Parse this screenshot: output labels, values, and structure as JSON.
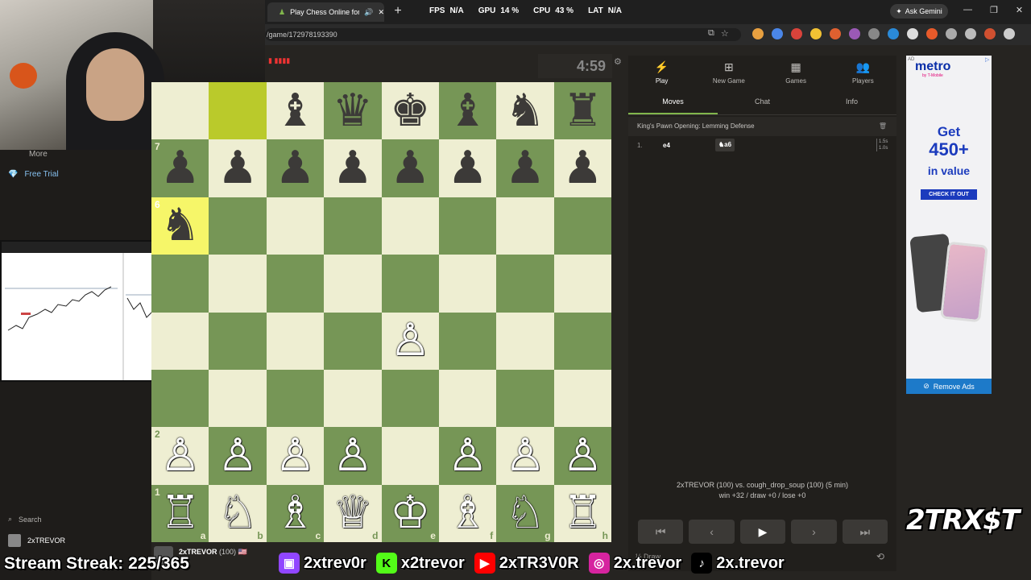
{
  "browser": {
    "tab_title": "Play Chess Online for FREE",
    "url": "/game/172978193390",
    "stats": [
      {
        "label": "FPS",
        "value": "N/A"
      },
      {
        "label": "GPU",
        "value": "14 %"
      },
      {
        "label": "CPU",
        "value": "43 %"
      },
      {
        "label": "LAT",
        "value": "N/A"
      }
    ],
    "gemini_label": "Ask Gemini"
  },
  "sidebar": {
    "more": "More",
    "free_trial": "Free Trial",
    "search": "Search",
    "user": "2xTREVOR"
  },
  "game": {
    "clock": "4:59",
    "player_name": "2xTREVOR",
    "player_rating": "(100)",
    "board": [
      [
        "",
        "",
        "♝",
        "♛",
        "♚",
        "♝",
        "♞",
        "♜"
      ],
      [
        "♟",
        "♟",
        "♟",
        "♟",
        "♟",
        "♟",
        "♟",
        "♟"
      ],
      [
        "♞",
        "",
        "",
        "",
        "",
        "",
        "",
        ""
      ],
      [
        "",
        "",
        "",
        "",
        "",
        "",
        "",
        ""
      ],
      [
        "",
        "",
        "",
        "",
        "♙",
        "",
        "",
        ""
      ],
      [
        "",
        "",
        "",
        "",
        "",
        "",
        "",
        ""
      ],
      [
        "♙",
        "♙",
        "♙",
        "♙",
        "",
        "♙",
        "♙",
        "♙"
      ],
      [
        "♖",
        "♘",
        "♗",
        "♕",
        "♔",
        "♗",
        "♘",
        "♖"
      ]
    ],
    "ranks_shown": [
      "7",
      "6",
      "2",
      "1"
    ],
    "files": [
      "a",
      "b",
      "c",
      "d",
      "e",
      "f",
      "g",
      "h"
    ]
  },
  "panel": {
    "nav": [
      {
        "icon": "⚡",
        "label": "Play"
      },
      {
        "icon": "⊞",
        "label": "New Game"
      },
      {
        "icon": "▦",
        "label": "Games"
      },
      {
        "icon": "👥",
        "label": "Players"
      }
    ],
    "tabs": [
      "Moves",
      "Chat",
      "Info"
    ],
    "opening": "King's Pawn Opening: Lemming Defense",
    "move_number": "1.",
    "white_move": "e4",
    "black_move": "♞a6",
    "time_white": "1.5s",
    "time_black": "1.0s",
    "match_players": "2xTREVOR (100) vs. cough_drop_soup (100) (5 min)",
    "match_stats": "win +32 / draw +0 / lose +0",
    "draw_label": "½ Draw"
  },
  "ad": {
    "brand": "metro",
    "brand_sub": "by T-Mobile",
    "get": "Get",
    "amount": "450+",
    "in_value": "in value",
    "cta": "CHECK IT OUT",
    "remove": "Remove Ads",
    "tag": "AD"
  },
  "overlay": {
    "streak": "Stream Streak: 225/365",
    "twitch": "2xtrev0r",
    "kick": "x2trevor",
    "youtube": "2xTR3V0R",
    "instagram": "2x.trevor",
    "tiktok": "2x.trevor",
    "brand": "2TRX$T"
  },
  "colors": {
    "board_light": "#eeeed2",
    "board_dark": "#769656",
    "highlight": "#f6f669",
    "accent": "#81b64c"
  }
}
